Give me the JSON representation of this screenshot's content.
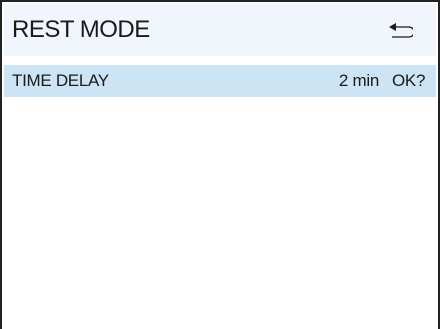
{
  "header": {
    "title": "REST MODE",
    "back_icon": "return-arrow-icon"
  },
  "settings": [
    {
      "label": "TIME DELAY",
      "value": "2 min",
      "confirm": "OK?"
    }
  ],
  "colors": {
    "header_bg": "#f0f6fb",
    "selected_row_bg": "#cde4f5",
    "border": "#222222",
    "text": "#1a1a1a"
  }
}
